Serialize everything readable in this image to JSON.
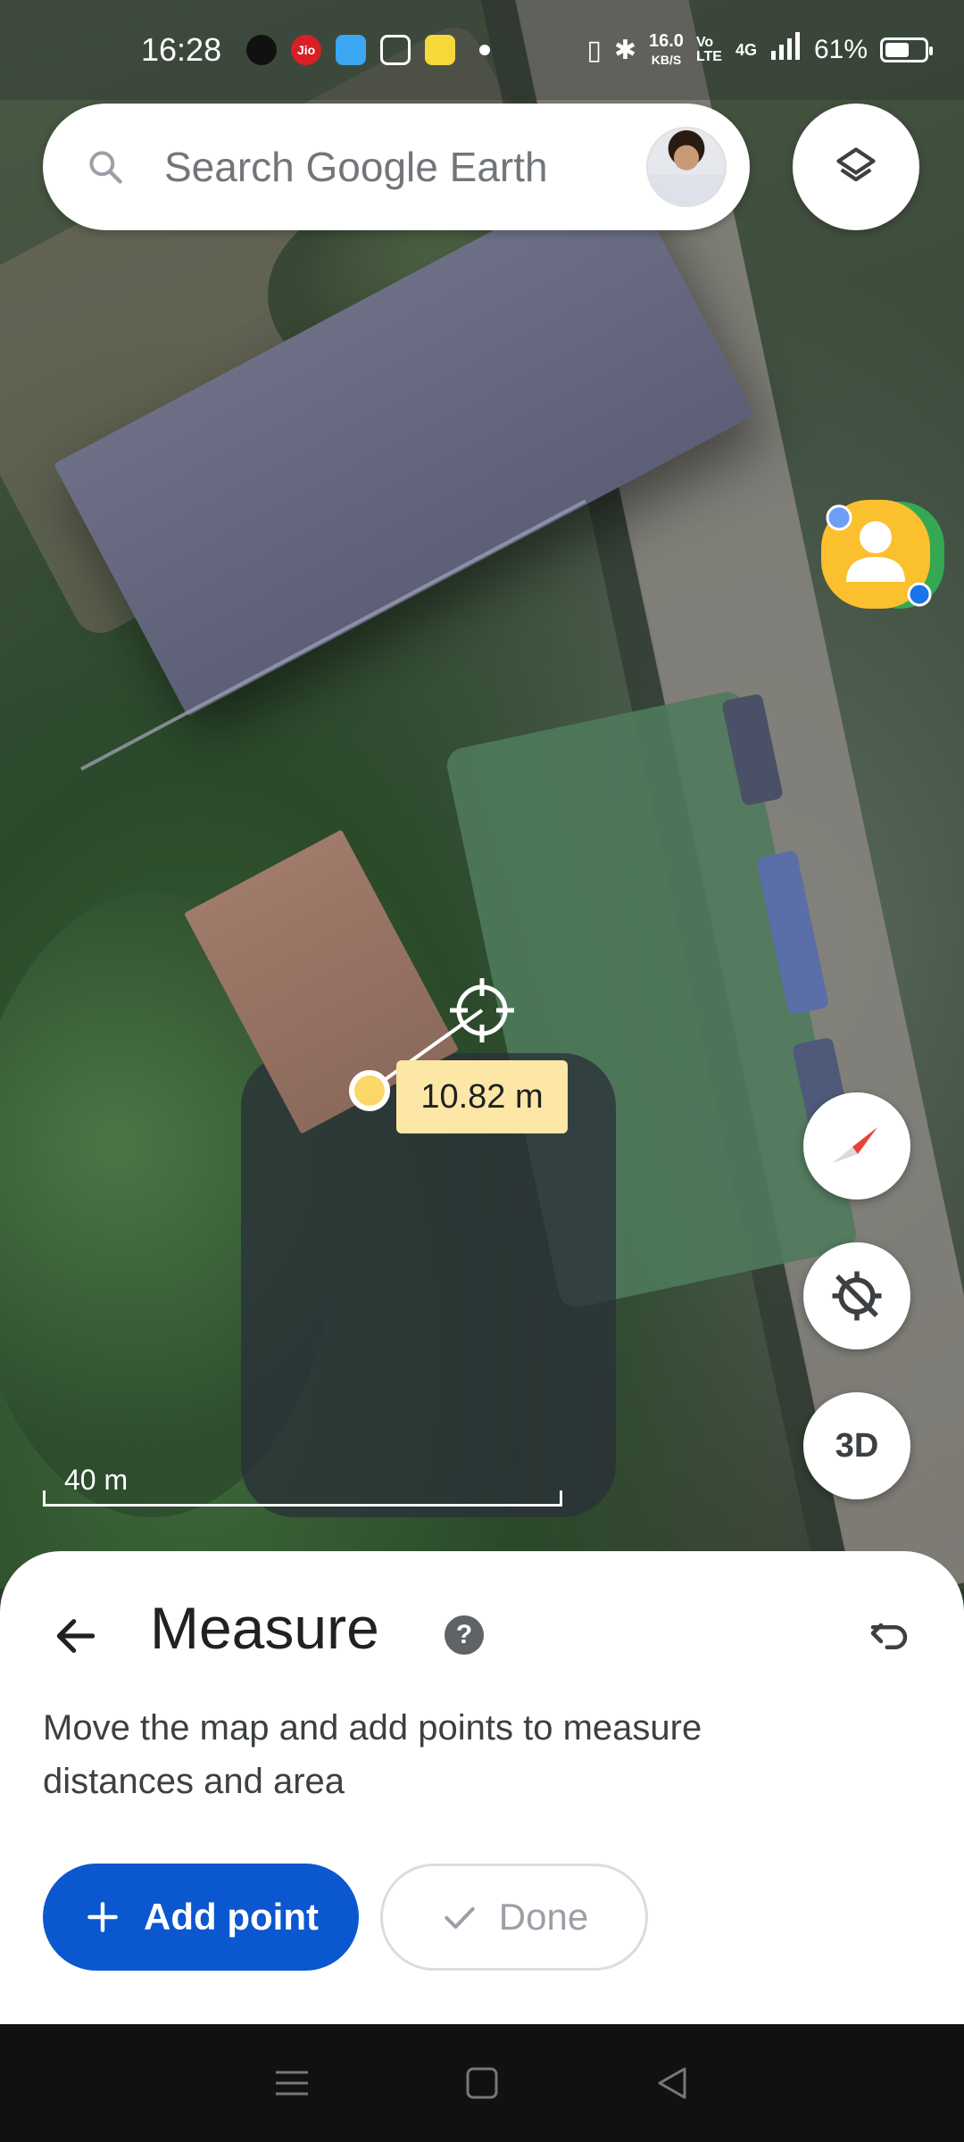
{
  "status_bar": {
    "time": "16:28",
    "net_speed_value": "16.0",
    "net_speed_unit": "KB/S",
    "volte": "Vo LTE",
    "network": "4G",
    "battery_percent": "61%",
    "battery_level": 0.61,
    "notification_icons": [
      "chat-bubble-icon",
      "jio-icon",
      "app-icon",
      "calculator-icon",
      "app-yellow-icon",
      "dot-icon"
    ]
  },
  "search": {
    "placeholder": "Search Google Earth"
  },
  "map": {
    "distance_label": "10.82 m",
    "scale_label": "40 m",
    "three_d_label": "3D"
  },
  "measure_sheet": {
    "title": "Measure",
    "help_symbol": "?",
    "description": "Move the map and add points to measure distances and area",
    "add_point_label": "Add point",
    "done_label": "Done"
  },
  "colors": {
    "primary_blue": "#0b57d0",
    "label_yellow": "#fde7a6",
    "point_yellow": "#fbd768"
  }
}
